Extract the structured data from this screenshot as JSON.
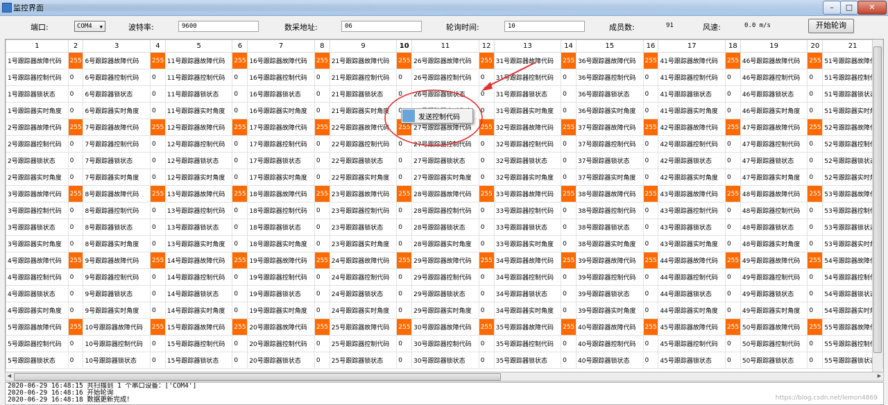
{
  "window": {
    "title": "监控界面",
    "buttons": [
      "–",
      "□",
      "✕"
    ]
  },
  "toolbar": {
    "port_label": "端口:",
    "port_value": "COM4",
    "baud_label": "波特率:",
    "baud_value": "9600",
    "addr_label": "数采地址:",
    "addr_value": "06",
    "poll_label": "轮询时间:",
    "poll_value": "10",
    "members_label": "成员数:",
    "members_value": "91",
    "wind_label": "风速:",
    "wind_value": "0.0 m/s",
    "start_label": "开始轮询"
  },
  "grid": {
    "columns": [
      "1",
      "2",
      "3",
      "4",
      "5",
      "6",
      "7",
      "8",
      "9",
      "10",
      "11",
      "12",
      "13",
      "14",
      "15",
      "16",
      "17",
      "18",
      "19",
      "20",
      "21"
    ],
    "highlight_column": "10",
    "row_suffixes": [
      "号跟踪器故障代码",
      "号跟踪器控制代码",
      "号跟踪器锁状态",
      "号跟踪器实时角度"
    ],
    "fault_value": "255",
    "other_value": "0",
    "groups": 5,
    "last_group_rows": 3
  },
  "context_menu": {
    "item": "发送控制代码"
  },
  "log": {
    "lines": [
      "2020-06-29 16:48:15 共扫描到 1 个串口设备：['COM4']",
      "2020-06-29 16:48:16 开始轮询",
      "2020-06-29 16:48:18 数据更新完成！"
    ]
  },
  "watermark": "https://blog.csdn.net/lemon4869",
  "colors": {
    "fault_highlight": "#ff6a00",
    "annotation": "#e03030"
  }
}
